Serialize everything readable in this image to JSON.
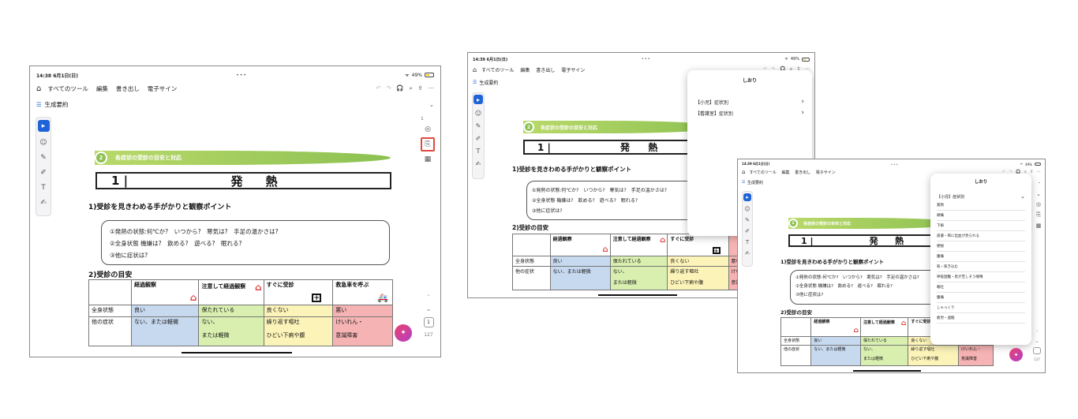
{
  "status": {
    "time1": "14:38 6月1日(日)",
    "time2": "14:39 6月1日(日)",
    "dots": "•••",
    "battery": "49%"
  },
  "toolbar": {
    "home_icon": "home-icon",
    "all_tools": "すべてのツール",
    "edit": "編集",
    "export": "書き出し",
    "esign": "電子サイン",
    "undo_icon": "undo-icon",
    "redo_icon": "redo-icon",
    "headphones_icon": "headphones-icon",
    "search_icon": "search-icon",
    "share_icon": "share-icon",
    "more_icon": "more-icon"
  },
  "subbar": {
    "label": "生成要約",
    "chevron": "⌄"
  },
  "document": {
    "section_number": "2",
    "section_title": "各症状の受診の目安と対応",
    "title_number": "1 |",
    "title_text": "発 熱",
    "heading1": "1)受診を見きわめる手がかりと観察ポイント",
    "points": [
      "①発熱の状態:何℃か?　いつから?　寒気は?　手足の温かさは?",
      "②全身状態 機嫌は?　飲める?　遊べる?　眠れる?",
      "③他に症状は?"
    ],
    "heading2": "2)受診の目安",
    "table": {
      "headers": [
        "経過観察",
        "注意して経過観察",
        "すぐに受診",
        "救急車を呼ぶ"
      ],
      "rows": [
        {
          "label": "全身状態",
          "cells": [
            "良い",
            "保たれている",
            "良くない",
            "悪い"
          ]
        },
        {
          "label": "他の症状",
          "cells": [
            "ない、または軽微",
            "ない、",
            "繰り返す嘔吐",
            "けいれん・"
          ]
        },
        {
          "label": "",
          "cells": [
            "",
            "または軽微",
            "ひどい下痢や腹",
            "意識障害"
          ]
        }
      ]
    }
  },
  "pager": {
    "current": "1",
    "total": "127",
    "badge": "1"
  },
  "bookmarks": {
    "title": "しおり",
    "top_items": [
      "【小児】症状別",
      "【看護室】症状別"
    ],
    "expanded_parent": "【小児】症状別",
    "children": [
      "発熱",
      "頭痛",
      "下痢",
      "皮膚・目に出血が見られる",
      "便秘",
      "腹痛",
      "咳・咳き込む",
      "呼吸困難・息が苦しそう喘鳴",
      "嘔吐",
      "腹痛",
      "しゃっくり",
      "疲労・過眠"
    ]
  },
  "colors": {
    "accent_blue": "#1f63d8",
    "highlight_red": "#e04a3f",
    "section_green": "#8cc152",
    "table_blue": "#c7d9ef",
    "table_green": "#d8efb0",
    "table_yellow": "#fbf3b8",
    "table_red": "#f6b3b3"
  }
}
